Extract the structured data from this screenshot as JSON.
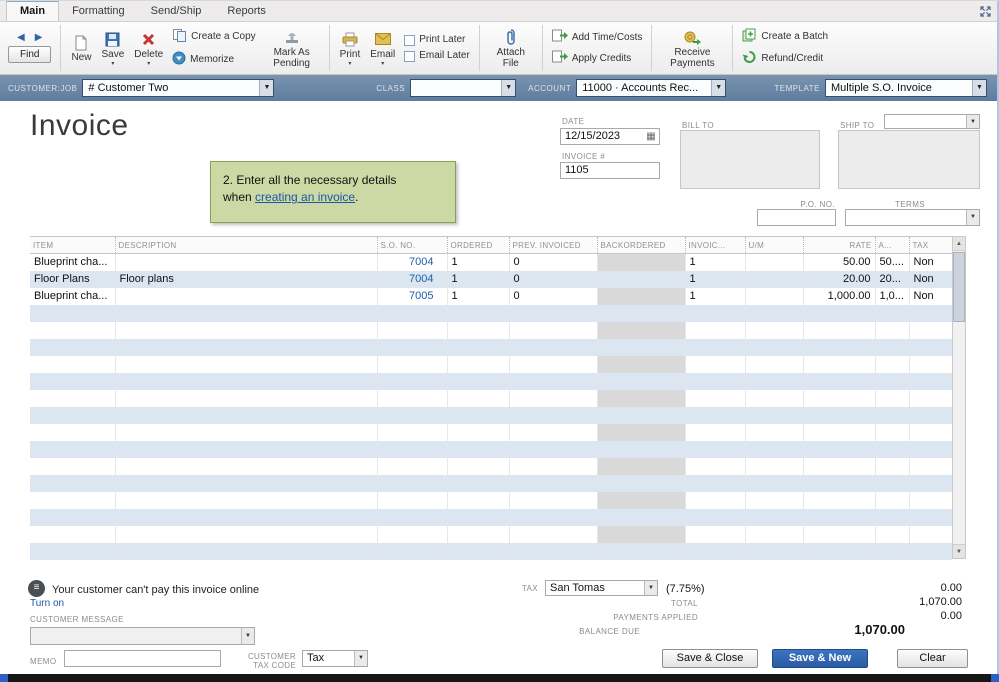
{
  "tabs": {
    "items": [
      {
        "label": "Main",
        "active": true
      },
      {
        "label": "Formatting",
        "active": false
      },
      {
        "label": "Send/Ship",
        "active": false
      },
      {
        "label": "Reports",
        "active": false
      }
    ]
  },
  "toolbar": {
    "find_label": "Find",
    "new_label": "New",
    "save_label": "Save",
    "delete_label": "Delete",
    "create_copy_label": "Create a Copy",
    "memorize_label": "Memorize",
    "mark_pending_label": "Mark As Pending",
    "print_label": "Print",
    "email_label": "Email",
    "print_later_label": "Print Later",
    "email_later_label": "Email Later",
    "attach_file_label": "Attach File",
    "add_time_costs_label": "Add Time/Costs",
    "apply_credits_label": "Apply Credits",
    "receive_payments_label": "Receive Payments",
    "create_batch_label": "Create a Batch",
    "refund_credit_label": "Refund/Credit"
  },
  "header_bar": {
    "customer_job": {
      "label": "CUSTOMER:JOB",
      "value": "# Customer Two"
    },
    "class": {
      "label": "CLASS",
      "value": ""
    },
    "account": {
      "label": "ACCOUNT",
      "value": "11000 · Accounts Rec..."
    },
    "template": {
      "label": "TEMPLATE",
      "value": "Multiple S.O. Invoice"
    }
  },
  "form": {
    "title": "Invoice",
    "date": {
      "label": "DATE",
      "value": "12/15/2023"
    },
    "invoice_no": {
      "label": "INVOICE #",
      "value": "1105"
    },
    "bill_to_label": "BILL TO",
    "ship_to_label": "SHIP TO",
    "po_no_label": "P.O. NO.",
    "terms_label": "TERMS"
  },
  "callout": {
    "line1": "2. Enter all the necessary details",
    "line2_prefix": "when ",
    "link_text": "creating an invoice",
    "line2_suffix": "."
  },
  "table": {
    "columns": [
      "ITEM",
      "DESCRIPTION",
      "S.O. NO.",
      "ORDERED",
      "PREV. INVOICED",
      "BACKORDERED",
      "INVOIC...",
      "U/M",
      "RATE",
      "A...",
      "TAX"
    ],
    "rows": [
      {
        "item": "Blueprint cha...",
        "description": "",
        "so_no": "7004",
        "ordered": "1",
        "prev_invoiced": "0",
        "backordered": "",
        "invoiced": "1",
        "um": "",
        "rate": "50.00",
        "amount": "50....",
        "tax": "Non"
      },
      {
        "item": "Floor Plans",
        "description": "Floor plans",
        "so_no": "7004",
        "ordered": "1",
        "prev_invoiced": "0",
        "backordered": "",
        "invoiced": "1",
        "um": "",
        "rate": "20.00",
        "amount": "20...",
        "tax": "Non"
      },
      {
        "item": "Blueprint cha...",
        "description": "",
        "so_no": "7005",
        "ordered": "1",
        "prev_invoiced": "0",
        "backordered": "",
        "invoiced": "1",
        "um": "",
        "rate": "1,000.00",
        "amount": "1,0...",
        "tax": "Non"
      }
    ],
    "empty_row_count": 15
  },
  "footer": {
    "online_payment_notice": "Your customer can't pay this invoice online",
    "turn_on_link": "Turn on",
    "customer_message_label": "CUSTOMER MESSAGE",
    "customer_message_value": "",
    "memo_label": "MEMO",
    "memo_value": "",
    "customer_tax_code_label_line1": "CUSTOMER",
    "customer_tax_code_label_line2": "TAX CODE",
    "customer_tax_code_value": "Tax",
    "tax_label": "TAX",
    "tax_name": "San Tomas",
    "tax_rate": "(7.75%)",
    "tax_amount": "0.00",
    "total_label": "TOTAL",
    "total_value": "1,070.00",
    "payments_applied_label": "PAYMENTS APPLIED",
    "payments_applied_value": "0.00",
    "balance_due_label": "BALANCE DUE",
    "balance_due_value": "1,070.00",
    "save_close_button": "Save & Close",
    "save_new_button": "Save & New",
    "clear_button": "Clear"
  },
  "icons": {
    "back": "◀",
    "forward": "▶",
    "caret": "▼",
    "small_caret": "▾",
    "calendar": "▦",
    "up_arrow": "▲",
    "down_arrow": "▼",
    "no_online_glyph": "≡"
  },
  "colors": {
    "header_bar_bg": "#64809f",
    "row_stripe": "#dbe6f0",
    "backordered_column": "#d9d9d9",
    "callout_bg": "#ccd9a4",
    "callout_border": "#8aa054",
    "save_new_button_bg": "#2e64ad",
    "link_blue": "#1b57a8",
    "so_no_link": "#1d5fa9"
  }
}
